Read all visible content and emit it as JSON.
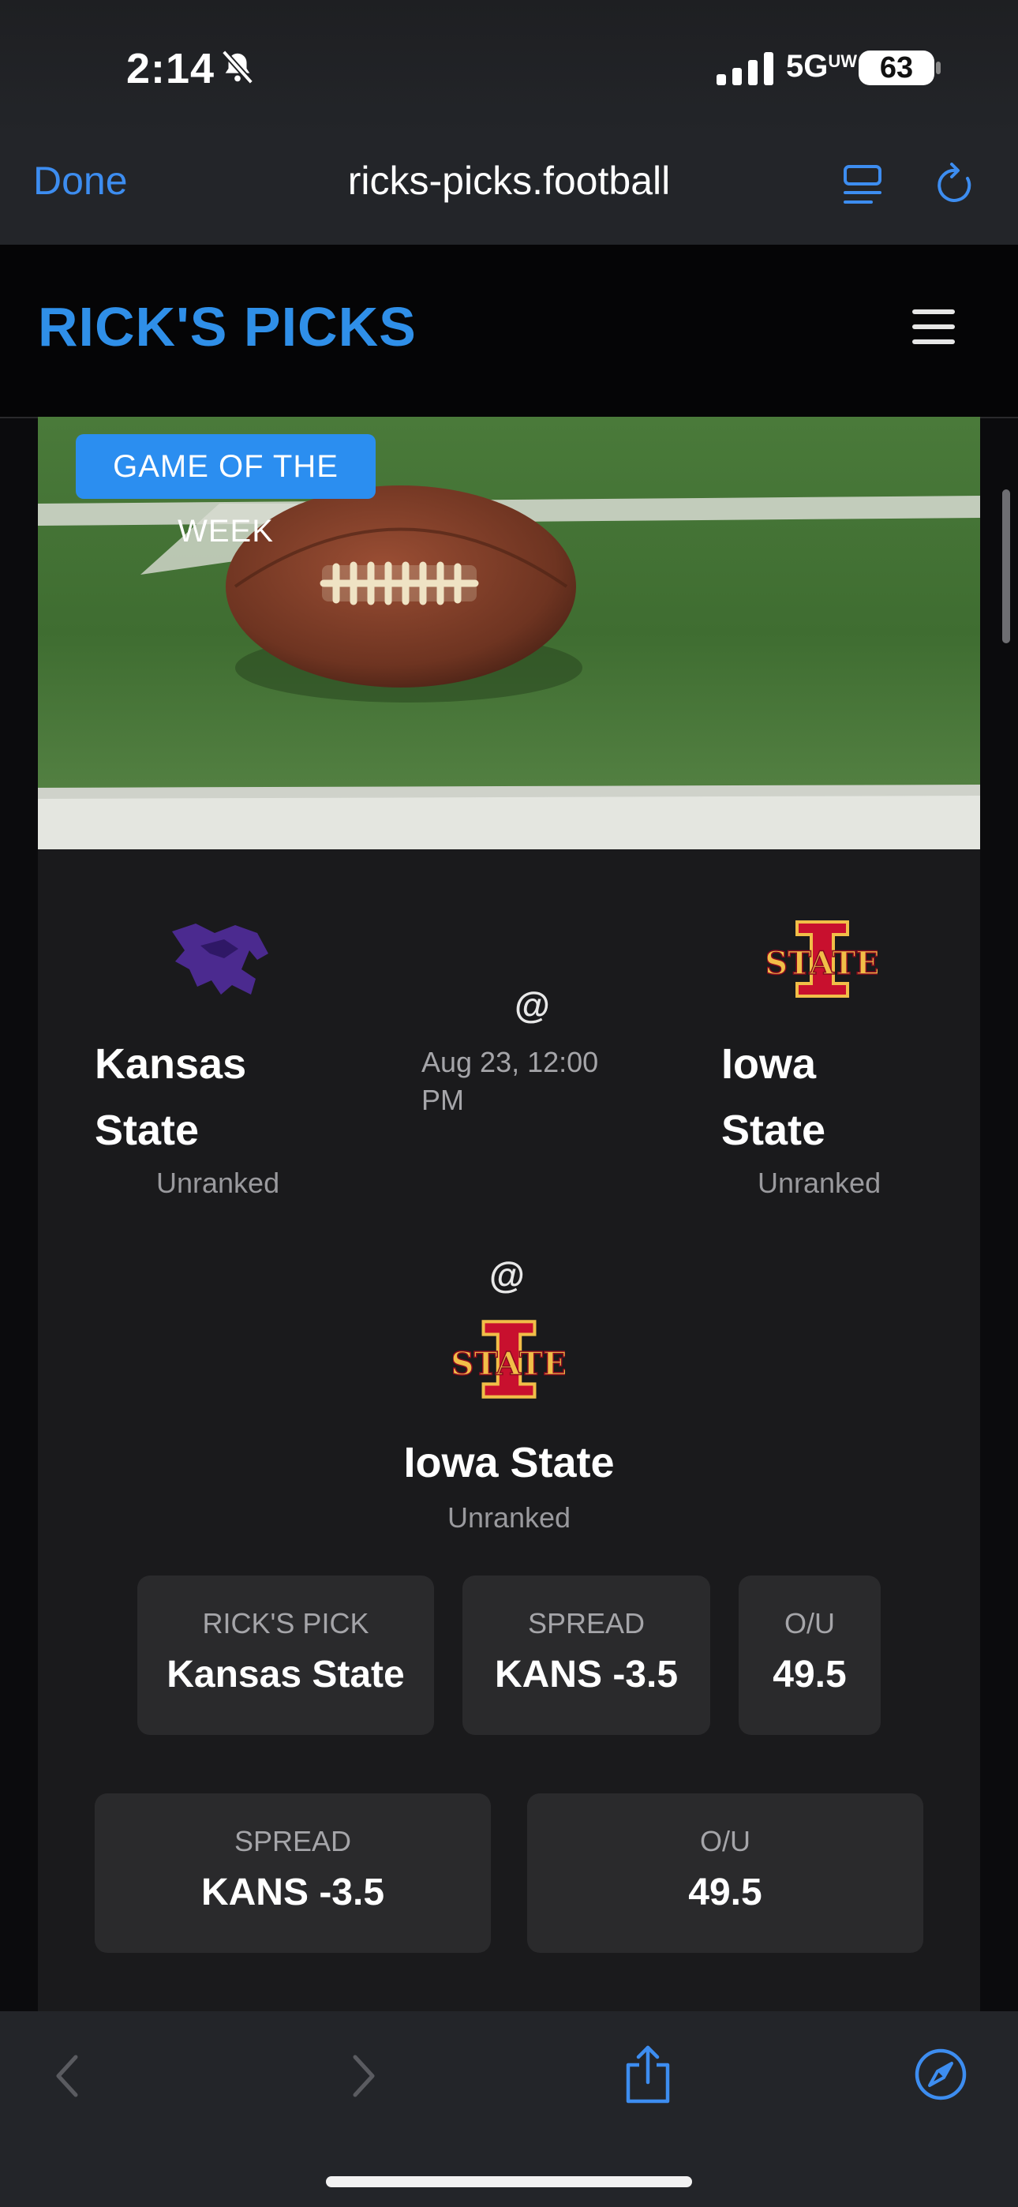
{
  "status": {
    "time": "2:14",
    "network": "5G",
    "network_sup": "UW",
    "battery": "63"
  },
  "browser": {
    "done_label": "Done",
    "url": "ricks-picks.football"
  },
  "site": {
    "logo": "RICK'S PICKS"
  },
  "hero": {
    "badge": "GAME OF THE WEEK"
  },
  "game": {
    "away": {
      "name_line1": "Kansas",
      "name_line2": "State",
      "rank": "Unranked"
    },
    "home": {
      "name_line1": "Iowa",
      "name_line2": "State",
      "rank": "Unranked"
    },
    "at": "@",
    "date_line1": "Aug 23, 12:00",
    "date_line2": "PM"
  },
  "stacked": {
    "at": "@",
    "team": "Iowa State",
    "rank": "Unranked"
  },
  "pick_row": [
    {
      "label": "RICK'S PICK",
      "value": "Kansas State"
    },
    {
      "label": "SPREAD",
      "value": "KANS -3.5"
    },
    {
      "label": "O/U",
      "value": "49.5"
    }
  ],
  "odds_row": [
    {
      "label": "SPREAD",
      "value": "KANS -3.5"
    },
    {
      "label": "O/U",
      "value": "49.5"
    }
  ],
  "colors": {
    "accent": "#2f8fe8",
    "kstate_purple": "#4b2a8f",
    "isu_red": "#c8102e",
    "isu_gold": "#f1be48"
  }
}
